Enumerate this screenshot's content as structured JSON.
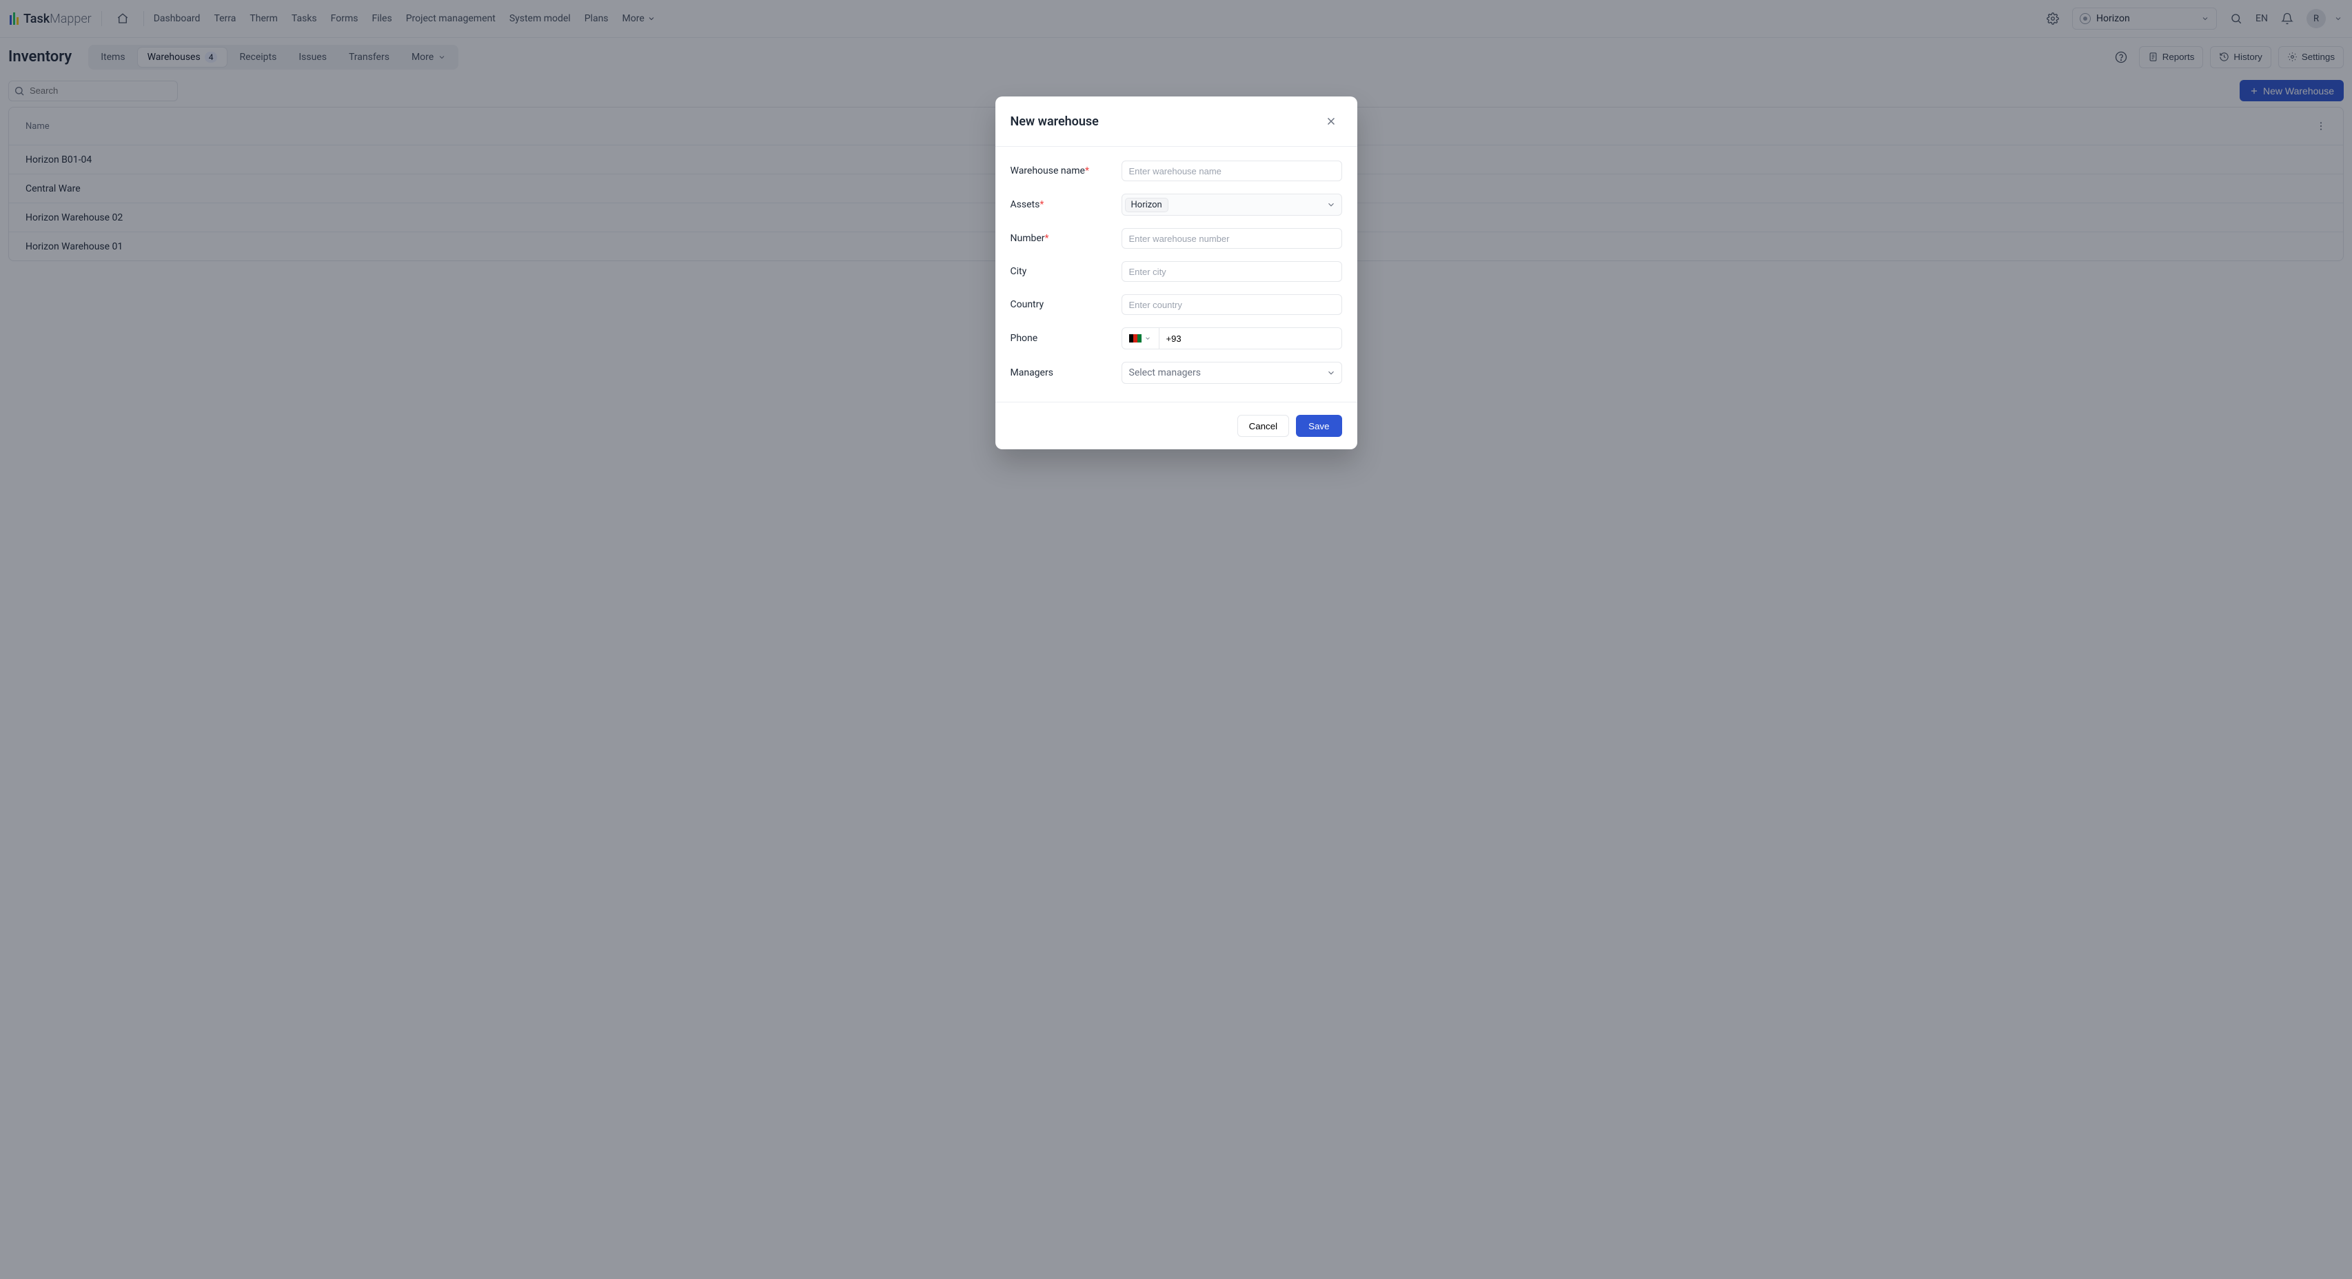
{
  "app": {
    "name1": "Task",
    "name2": "Mapper"
  },
  "nav": {
    "items": [
      "Dashboard",
      "Terra",
      "Therm",
      "Tasks",
      "Forms",
      "Files",
      "Project management",
      "System model",
      "Plans"
    ],
    "more": "More"
  },
  "header_right": {
    "asset_selected": "Horizon",
    "lang": "EN",
    "avatar": "R"
  },
  "toolbar": {
    "title": "Inventory",
    "tabs": [
      {
        "label": "Items"
      },
      {
        "label": "Warehouses",
        "badge": "4",
        "active": true
      },
      {
        "label": "Receipts"
      },
      {
        "label": "Issues"
      },
      {
        "label": "Transfers"
      },
      {
        "label": "More"
      }
    ],
    "reports": "Reports",
    "history": "History",
    "settings": "Settings"
  },
  "filter": {
    "search_placeholder": "Search",
    "new_button": "New Warehouse"
  },
  "table": {
    "columns": [
      "Name"
    ],
    "rows": [
      {
        "name": "Horizon B01-04"
      },
      {
        "name": "Central Ware"
      },
      {
        "name": "Horizon Warehouse 02"
      },
      {
        "name": "Horizon Warehouse 01"
      }
    ]
  },
  "modal": {
    "title": "New warehouse",
    "labels": {
      "name": "Warehouse name",
      "assets": "Assets",
      "number": "Number",
      "city": "City",
      "country": "Country",
      "phone": "Phone",
      "managers": "Managers"
    },
    "placeholders": {
      "name": "Enter warehouse name",
      "number": "Enter warehouse number",
      "city": "Enter city",
      "country": "Enter country",
      "managers": "Select managers"
    },
    "values": {
      "assets_chip": "Horizon",
      "phone_prefix": "+93"
    },
    "buttons": {
      "cancel": "Cancel",
      "save": "Save"
    }
  }
}
